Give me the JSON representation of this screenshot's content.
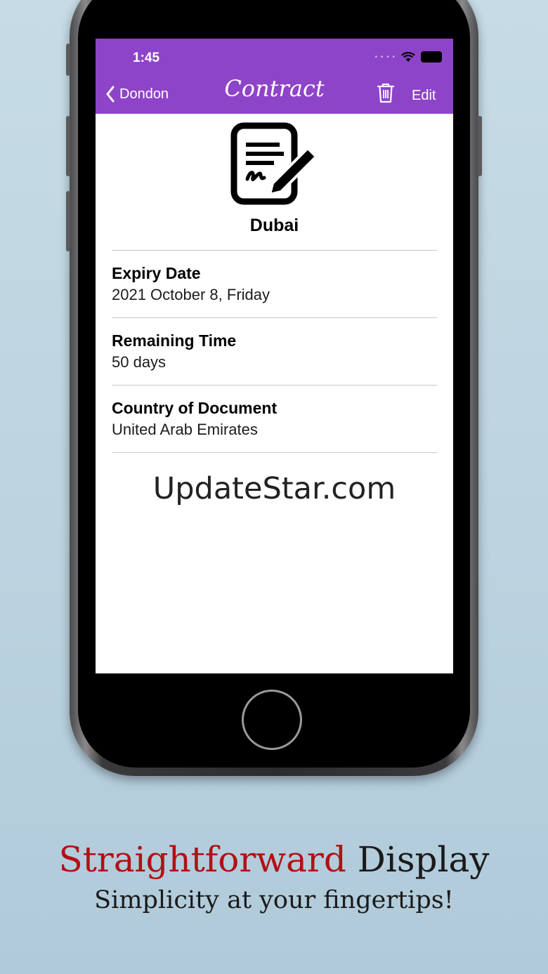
{
  "status_bar": {
    "time": "1:45"
  },
  "navbar": {
    "back_label": "Dondon",
    "title": "Contract",
    "edit_label": "Edit"
  },
  "document": {
    "name": "Dubai",
    "fields": [
      {
        "label": "Expiry Date",
        "value": "2021 October 8, Friday"
      },
      {
        "label": "Remaining Time",
        "value": "50 days"
      },
      {
        "label": "Country of Document",
        "value": "United Arab Emirates"
      }
    ]
  },
  "watermark": "UpdateStar.com",
  "promo": {
    "headline_highlight": "Straightforward",
    "headline_rest": "Display",
    "subheadline": "Simplicity at your fingertips!"
  },
  "colors": {
    "navbar": "#8e44c9",
    "headline_red": "#b21015",
    "background": "#c6dbe5"
  },
  "icons": [
    "chevron-left-icon",
    "trash-icon",
    "signed-document-icon",
    "wifi-icon",
    "battery-icon"
  ]
}
